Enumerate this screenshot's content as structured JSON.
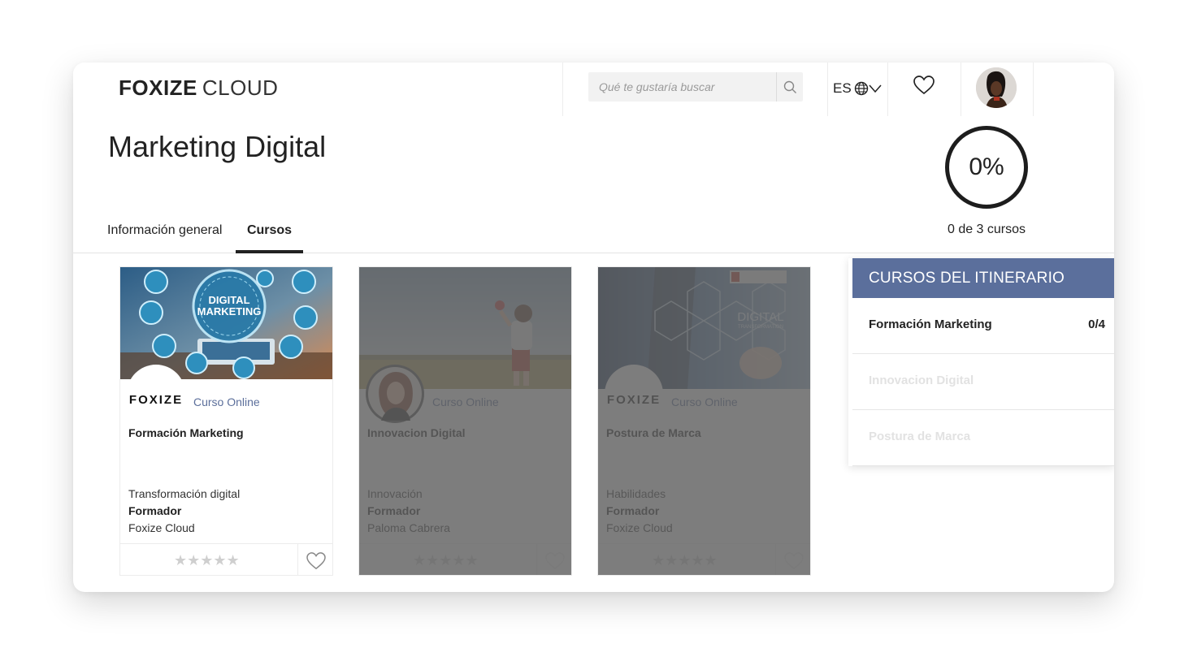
{
  "brand": {
    "name_bold": "FOXIZE",
    "name_light": "CLOUD"
  },
  "header": {
    "search_placeholder": "Qué te gustaría buscar",
    "language": "ES"
  },
  "page": {
    "title": "Marketing Digital",
    "tabs": [
      {
        "label": "Información general",
        "active": false
      },
      {
        "label": "Cursos",
        "active": true
      }
    ],
    "progress": {
      "percent_label": "0%",
      "caption": "0 de 3 cursos"
    }
  },
  "cards": [
    {
      "type": "Curso Online",
      "title": "Formación Marketing",
      "category": "Transformación digital",
      "trainer_label": "Formador",
      "trainer": "Foxize Cloud",
      "rating": 0,
      "image_text": [
        "DIGITAL",
        "MARKETING"
      ],
      "logo_text": "FOXIZE"
    },
    {
      "type": "Curso Online",
      "title": "Innovacion Digital",
      "category": "Innovación",
      "trainer_label": "Formador",
      "trainer": "Paloma Cabrera",
      "rating": 0
    },
    {
      "type": "Curso Online",
      "title": "Postura de Marca",
      "category": "Habilidades",
      "trainer_label": "Formador",
      "trainer": "Foxize Cloud",
      "rating": 0,
      "image_text": [
        "DIGITAL",
        "TRANSFORMATION"
      ],
      "logo_text": "FOXIZE"
    }
  ],
  "sidebar": {
    "title": "CURSOS DEL ITINERARIO",
    "items": [
      {
        "name": "Formación Marketing",
        "count": "0/4",
        "active": true
      },
      {
        "name": "Innovacion Digital",
        "active": false
      },
      {
        "name": "Postura de Marca",
        "active": false
      }
    ]
  },
  "colors": {
    "accent": "#5b6f9c",
    "text": "#222222",
    "dim_overlay": "#606060"
  }
}
